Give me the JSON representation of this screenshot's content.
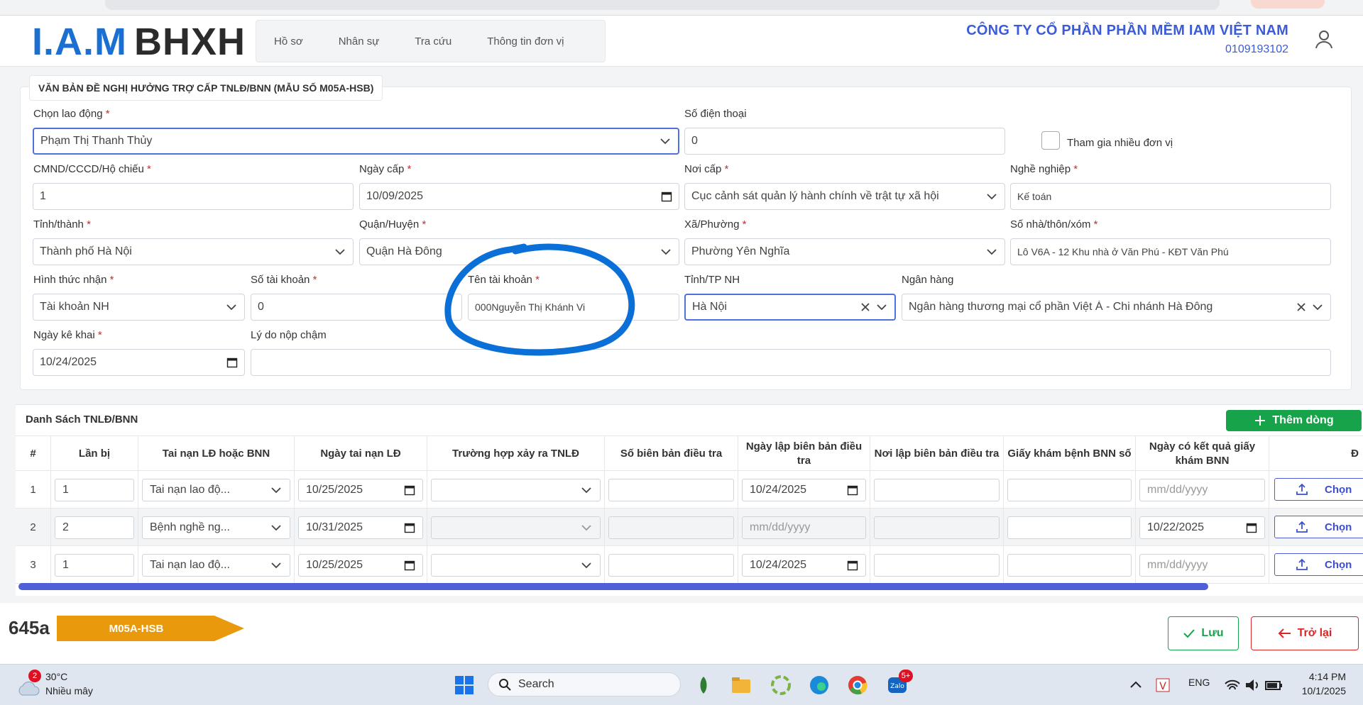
{
  "header": {
    "logo_iam": "I.A.M",
    "logo_bhxh": "BHXH",
    "nav": [
      "Hồ sơ",
      "Nhân sự",
      "Tra cứu",
      "Thông tin đơn vị"
    ],
    "company_name": "CÔNG TY CỔ PHẦN PHẦN MỀM IAM VIỆT NAM",
    "tax_code": "0109193102"
  },
  "form": {
    "title": "VĂN BẢN ĐỀ NGHỊ HƯỞNG TRỢ CẤP TNLĐ/BNN (MẪU SỐ M05A-HSB)",
    "labels": {
      "employee": "Chọn lao động",
      "phone": "Số điện thoại",
      "multi_unit": "Tham gia nhiều đơn vị",
      "id_number": "CMND/CCCD/Hộ chiếu",
      "issue_date": "Ngày cấp",
      "issue_place": "Nơi cấp",
      "occupation": "Nghề nghiệp",
      "province": "Tỉnh/thành",
      "district": "Quận/Huyện",
      "ward": "Xã/Phường",
      "address": "Số nhà/thôn/xóm",
      "receive_method": "Hình thức nhận",
      "account_no": "Số tài khoản",
      "account_name": "Tên tài khoản",
      "bank_province": "Tỉnh/TP NH",
      "bank": "Ngân hàng",
      "declare_date": "Ngày kê khai",
      "late_reason": "Lý do nộp chậm"
    },
    "values": {
      "employee": "Phạm Thị Thanh Thủy",
      "phone": "0",
      "id_number": "1",
      "issue_date": "10/09/2025",
      "issue_place": "Cục cảnh sát quản lý hành chính về trật tự xã hội",
      "occupation": "Kế toán",
      "province": "Thành phố Hà Nội",
      "district": "Quận Hà Đông",
      "ward": "Phường Yên Nghĩa",
      "address": "Lô V6A - 12 Khu nhà ở Văn Phú - KĐT Văn Phú",
      "receive_method": "Tài khoản NH",
      "account_no": "0",
      "account_name": "000Nguyễn Thị Khánh Vi",
      "bank_province": "Hà Nội",
      "bank": "Ngân hàng thương mại cổ phần Việt Á - Chi nhánh Hà Đông",
      "declare_date": "10/24/2025",
      "late_reason": ""
    }
  },
  "table": {
    "title": "Danh Sách TNLĐ/BNN",
    "add_label": "Thêm dòng",
    "headers": [
      "#",
      "Lần bị",
      "Tai nạn LĐ hoặc BNN",
      "Ngày tai nạn LĐ",
      "Trường hợp xảy ra TNLĐ",
      "Số biên bản điều tra",
      "Ngày lập biên bản điều tra",
      "Nơi lập biên bản điều tra",
      "Giấy khám bệnh BNN số",
      "Ngày có kết quả giấy khám BNN",
      "Đ"
    ],
    "date_placeholder": "mm/dd/yyyy",
    "choose_label": "Chọn",
    "rows": [
      {
        "idx": "1",
        "times": "1",
        "type": "Tai nạn lao độ...",
        "accident_date": "10/25/2025",
        "report_date": "10/24/2025",
        "result_date": ""
      },
      {
        "idx": "2",
        "times": "2",
        "type": "Bệnh nghề ng...",
        "accident_date": "10/31/2025",
        "report_date": "",
        "result_date": "10/22/2025"
      },
      {
        "idx": "3",
        "times": "1",
        "type": "Tai nạn lao độ...",
        "accident_date": "10/25/2025",
        "report_date": "10/24/2025",
        "result_date": ""
      }
    ]
  },
  "footer": {
    "code_number": "645a",
    "code_label": "M05A-HSB",
    "save_label": "Lưu",
    "back_label": "Trở lại"
  },
  "taskbar": {
    "weather_badge": "2",
    "temperature": "30°C",
    "weather_desc": "Nhiều mây",
    "search_placeholder": "Search",
    "zalo_badge": "5+",
    "language": "ENG",
    "time": "4:14 PM",
    "date": "10/1/2025"
  },
  "colors": {
    "brand_blue": "#1a6fd1",
    "accent": "#4f5fd8",
    "green": "#16a34a",
    "red": "#dc2626",
    "orange": "#e89a0c",
    "annotation": "#0a6fd6"
  }
}
